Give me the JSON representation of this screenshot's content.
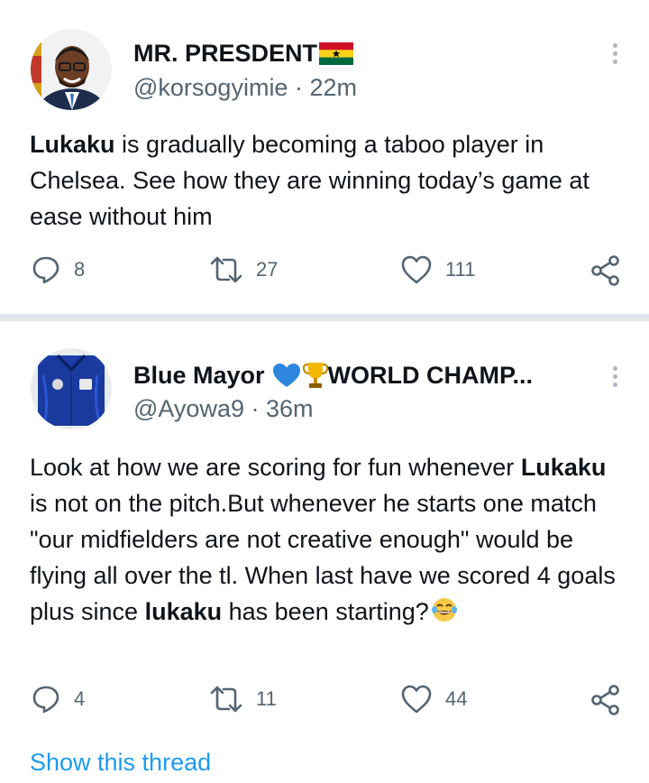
{
  "tweets": [
    {
      "name": "MR. PRESDENT",
      "name_suffix_emoji": "ghana-flag",
      "handle": "@korsogyimie",
      "time": "22m",
      "text_parts": [
        {
          "bold": true,
          "text": "Lukaku"
        },
        {
          "bold": false,
          "text": " is gradually becoming a taboo player in Chelsea. See how they are winning today’s game at ease without him"
        }
      ],
      "replies": "8",
      "retweets": "27",
      "likes": "111"
    },
    {
      "name": "Blue Mayor",
      "name_emojis": [
        "blue-heart",
        "trophy"
      ],
      "name_tail": "WORLD CHAMP...",
      "handle": "@Ayowa9",
      "time": "36m",
      "text_parts": [
        {
          "bold": false,
          "text": "Look at how we are scoring for fun whenever "
        },
        {
          "bold": true,
          "text": "Lukaku"
        },
        {
          "bold": false,
          "text": " is not on the pitch.But whenever he starts one match \"our midfielders are not creative enough\" would be flying all over the tl. When last have we scored 4 goals plus since "
        },
        {
          "bold": true,
          "text": "lukaku"
        },
        {
          "bold": false,
          "text": " has been starting?"
        }
      ],
      "text_end_emoji": "tears-of-joy",
      "replies": "4",
      "retweets": "11",
      "likes": "44",
      "show_thread": "Show this thread"
    }
  ],
  "colors": {
    "link": "#1d9bf0",
    "secondary": "#536471",
    "divider": "#e1e8ed"
  }
}
